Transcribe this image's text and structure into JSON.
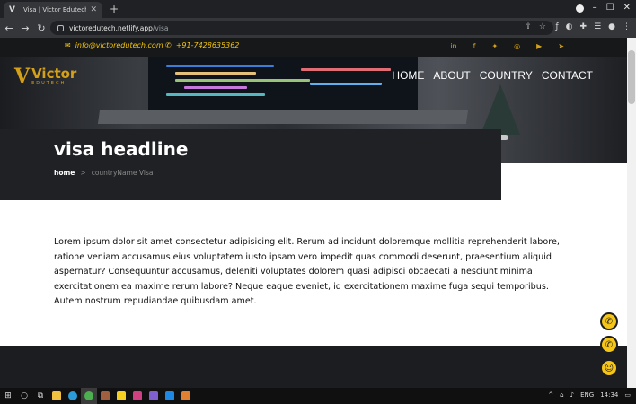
{
  "browser": {
    "tab_title": "Visa | Victor Edutech",
    "tab_favicon": "V",
    "url_host": "victoredutech.netlify.app",
    "url_path": "/visa"
  },
  "topbar": {
    "email": "info@victoredutech.com",
    "phone": "+91-7428635362",
    "social_icons": [
      "linkedin-icon",
      "facebook-icon",
      "twitter-icon",
      "instagram-icon",
      "youtube-icon",
      "telegram-icon"
    ]
  },
  "header": {
    "logo_mark": "V",
    "logo_name": "Victor",
    "logo_sub": "EDUTECH",
    "nav": [
      "HOME",
      "ABOUT",
      "COUNTRY",
      "CONTACT"
    ]
  },
  "banner": {
    "headline": "visa headline",
    "breadcrumb_home": "home",
    "breadcrumb_sep": ">",
    "breadcrumb_current": "countryName Visa"
  },
  "content": {
    "paragraph": "Lorem ipsum dolor sit amet consectetur adipisicing elit. Rerum ad incidunt doloremque mollitia reprehenderit labore, ratione veniam accusamus eius voluptatem iusto ipsam vero impedit quas commodi deserunt, praesentium aliquid aspernatur? Consequuntur accusamus, deleniti voluptates dolorem quasi adipisci obcaecati a nesciunt minima exercitationem ea maxime rerum labore? Neque eaque eveniet, id exercitationem maxime fuga sequi temporibus. Autem nostrum repudiandae quibusdam amet."
  },
  "floating_actions": [
    "phone-icon",
    "whatsapp-icon",
    "support-icon"
  ],
  "taskbar": {
    "lang": "ENG",
    "time": "14:34"
  },
  "colors": {
    "accent": "#f5c518",
    "dark": "#1f2124",
    "topbar": "#17181a"
  }
}
